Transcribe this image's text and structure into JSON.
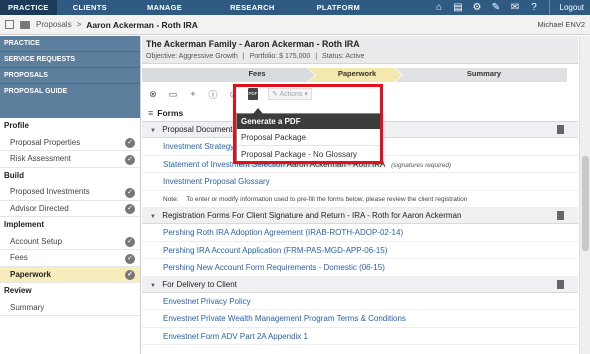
{
  "topnav": {
    "tabs": [
      {
        "label": "PRACTICE",
        "active": true
      },
      {
        "label": "CLIENTS",
        "active": false
      },
      {
        "label": "MANAGE",
        "active": false
      },
      {
        "label": "RESEARCH",
        "active": false
      },
      {
        "label": "PLATFORM",
        "active": false
      }
    ],
    "icons": [
      "home-icon",
      "print-icon",
      "gear-icon",
      "wrench-icon",
      "chat-icon",
      "help-icon"
    ],
    "logout_label": "Logout"
  },
  "breadcrumb": {
    "proposals": "Proposals",
    "separator": ">",
    "current": "Aaron Ackerman - Roth IRA",
    "user": "Michael ENV2"
  },
  "sidebar": {
    "sections": [
      "PRACTICE",
      "SERVICE REQUESTS",
      "PROPOSALS"
    ],
    "guide_title": "PROPOSAL GUIDE",
    "groups": [
      {
        "title": "Profile",
        "items": [
          {
            "label": "Proposal Properties",
            "checked": true,
            "active": false
          },
          {
            "label": "Risk Assessment",
            "checked": true,
            "active": false
          }
        ]
      },
      {
        "title": "Build",
        "items": [
          {
            "label": "Proposed Investments",
            "checked": true,
            "active": false
          },
          {
            "label": "Advisor Directed",
            "checked": true,
            "active": false
          }
        ]
      },
      {
        "title": "Implement",
        "items": [
          {
            "label": "Account Setup",
            "checked": true,
            "active": false
          },
          {
            "label": "Fees",
            "checked": true,
            "active": false
          },
          {
            "label": "Paperwork",
            "checked": true,
            "active": true
          }
        ]
      },
      {
        "title": "Review",
        "items": [
          {
            "label": "Summary",
            "checked": false,
            "active": false
          }
        ]
      }
    ]
  },
  "header": {
    "title": "The Ackerman Family - Aaron Ackerman - Roth IRA",
    "objective": "Objective: Aggressive Growth",
    "portfolio": "Portfolio: $ 175,000",
    "status": "Status: Active",
    "sep": "|"
  },
  "steps": [
    "Fees",
    "Paperwork",
    "Summary"
  ],
  "toolbar": {
    "actions_label": "Actions"
  },
  "forms_label": "Forms",
  "sections": [
    {
      "title": "Proposal Documents",
      "rows": [
        {
          "link": "Investment Strategy",
          "plain": "",
          "note": ""
        },
        {
          "link": "Statement of Investment Selection",
          "plain": "Aaron Ackerman - Roth IRA",
          "note": "(signatures required)"
        },
        {
          "link": "Investment Proposal Glossary",
          "plain": "",
          "note": ""
        }
      ],
      "note_label": "Note:",
      "note_text": "To enter or modify information used to pre-fill the forms below, please review the client registration"
    },
    {
      "title": "Registration Forms For Client Signature and Return - IRA - Roth for Aaron Ackerman",
      "rows": [
        {
          "link": "Pershing Roth IRA Adoption Agreement (IRAB-ROTH-ADOP-02-14)"
        },
        {
          "link": "Pershing IRA Account Application (FRM-PAS-MGD-APP-06-15)"
        },
        {
          "link": "Pershing New Account Form Requirements - Domestic (06-15)"
        }
      ]
    },
    {
      "title": "For Delivery to Client",
      "rows": [
        {
          "link": "Envestnet Privacy Policy"
        },
        {
          "link": "Envestnet Private Wealth Management Program Terms & Conditions"
        },
        {
          "link": "Envestnet Form ADV Part 2A Appendix 1"
        }
      ]
    }
  ],
  "popup": {
    "title": "Generate a PDF",
    "items": [
      "Proposal Package",
      "Proposal Package - No Glossary"
    ]
  },
  "colors": {
    "nav": "#2f5b83",
    "sidebar_section": "#5c7f9e",
    "active_item": "#f7ecbc",
    "link": "#2a63a8",
    "highlight": "#e3101b"
  }
}
